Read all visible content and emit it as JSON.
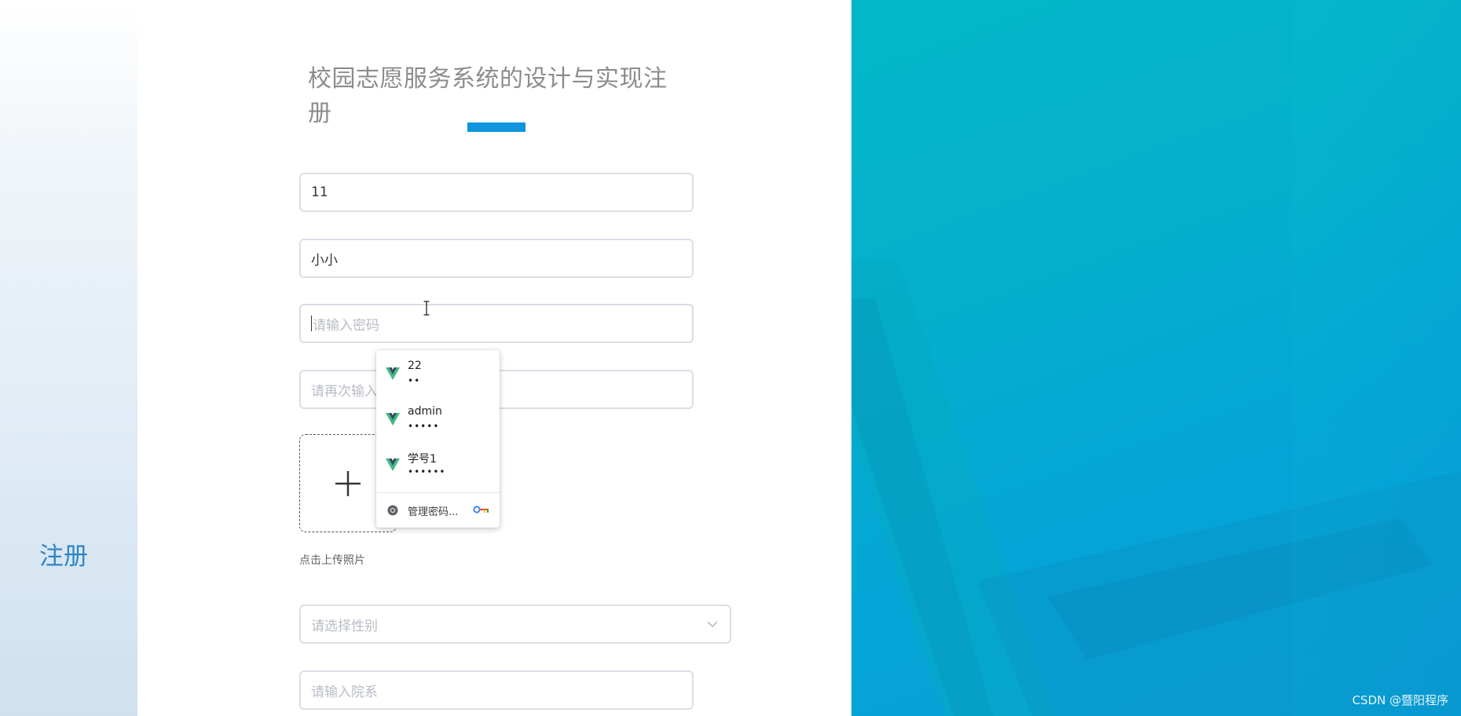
{
  "page": {
    "side_title": "注册",
    "form_title": "校园志愿服务系统的设计与实现注册",
    "watermark": "CSDN @暨阳程序"
  },
  "form": {
    "account": {
      "value": "11",
      "placeholder": ""
    },
    "name": {
      "value": "小小",
      "placeholder": ""
    },
    "password": {
      "value": "",
      "placeholder": "请输入密码"
    },
    "confirm_password": {
      "value": "",
      "placeholder": "请再次输入"
    },
    "upload_hint": "点击上传照片",
    "gender": {
      "placeholder": "请选择性别"
    },
    "department": {
      "value": "",
      "placeholder": "请输入院系"
    }
  },
  "autofill": {
    "items": [
      {
        "username": "22",
        "masked": "••"
      },
      {
        "username": "admin",
        "masked": "•••••"
      },
      {
        "username": "学号1",
        "masked": "••••••"
      }
    ],
    "manage_label": "管理密码..."
  },
  "colors": {
    "accent": "#0d95de",
    "side_title": "#2f86c5",
    "right_panel": "#04a5d6"
  },
  "icons": {
    "upload": "plus-icon",
    "select": "chevron-down-icon",
    "autofill_entry": "vue-logo-icon",
    "manage": "chrome-icon",
    "manage_key": "key-icon",
    "cursor": "text-cursor-icon"
  }
}
